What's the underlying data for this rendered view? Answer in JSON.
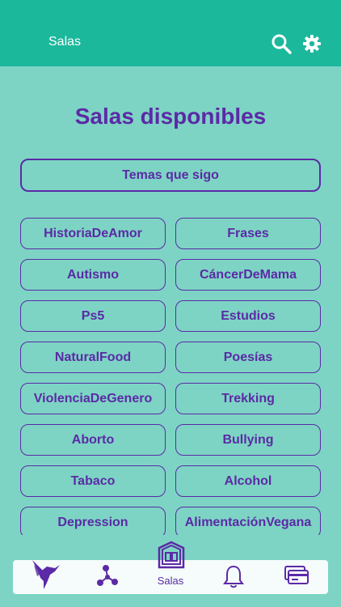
{
  "appbar": {
    "title": "Salas"
  },
  "page": {
    "title": "Salas disponibles",
    "followed_label": "Temas que sigo"
  },
  "rooms": [
    "HistoriaDeAmor",
    "Frases",
    "Autismo",
    "CáncerDeMama",
    "Ps5",
    "Estudios",
    "NaturalFood",
    "Poesías",
    "ViolenciaDeGenero",
    "Trekking",
    "Aborto",
    "Bullying",
    "Tabaco",
    "Alcohol",
    "Depression",
    "AlimentaciónVegana"
  ],
  "nav": {
    "rooms_label": "Salas"
  },
  "icons": {
    "search": "search-icon",
    "settings": "gear-icon",
    "bird": "hummingbird-icon",
    "graph": "network-icon",
    "rooms": "room-door-icon",
    "bell": "bell-icon",
    "card": "card-icon"
  },
  "colors": {
    "appbar": "#1bb89c",
    "background": "#7dd4c4",
    "accent": "#5b2aa6"
  }
}
